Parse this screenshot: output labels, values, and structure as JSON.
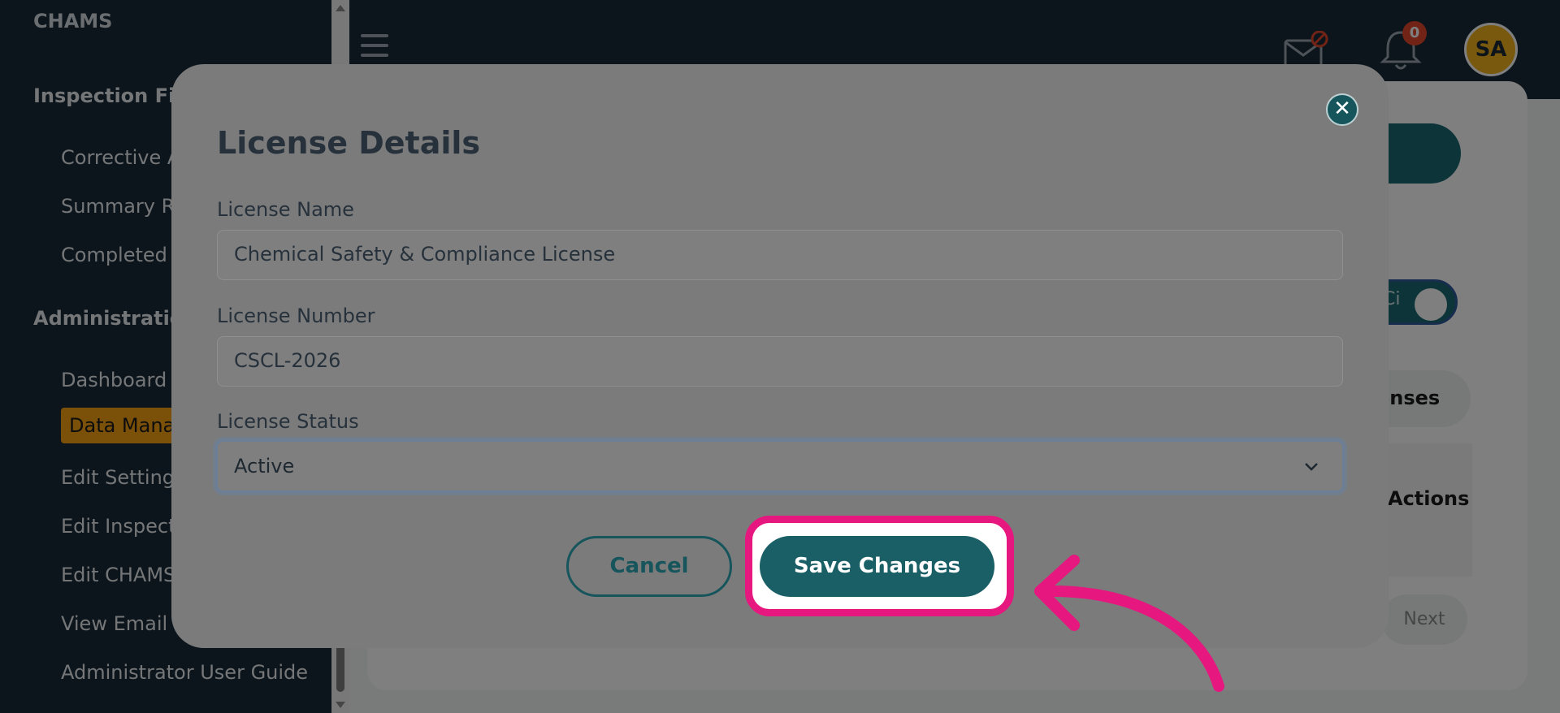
{
  "app": {
    "brand": "CHAMS"
  },
  "sidebar": {
    "sections": [
      {
        "title": "Inspection Fine",
        "items": [
          "Corrective A",
          "Summary Re",
          "Completed I"
        ]
      },
      {
        "title": "Administration",
        "items": [
          "Dashboard",
          "Data Mana",
          "Edit Settings",
          "Edit Inspect",
          "Edit CHAMS",
          "View Email L",
          "Administrator User Guide"
        ]
      }
    ],
    "active_item": "Data Mana"
  },
  "header": {
    "notification_count": "0",
    "avatar_initials": "SA",
    "icons": [
      "menu-icon",
      "mail-disabled-icon",
      "bell-icon"
    ]
  },
  "background_page": {
    "toggle_label": "Ci",
    "tab_label": "enses",
    "table_column": "Actions",
    "next_label": "Next"
  },
  "modal": {
    "title": "License Details",
    "close_icon": "close-icon",
    "fields": {
      "license_name": {
        "label": "License Name",
        "value": "Chemical Safety & Compliance License"
      },
      "license_number": {
        "label": "License Number",
        "value": "CSCL-2026"
      },
      "license_status": {
        "label": "License Status",
        "value": "Active"
      }
    },
    "buttons": {
      "cancel": "Cancel",
      "save": "Save Changes"
    }
  },
  "colors": {
    "accent": "#1b5f66",
    "highlight": "#e6177f",
    "active_nav": "#f7a214",
    "badge": "#e2492b",
    "avatar": "#f3b21c"
  }
}
